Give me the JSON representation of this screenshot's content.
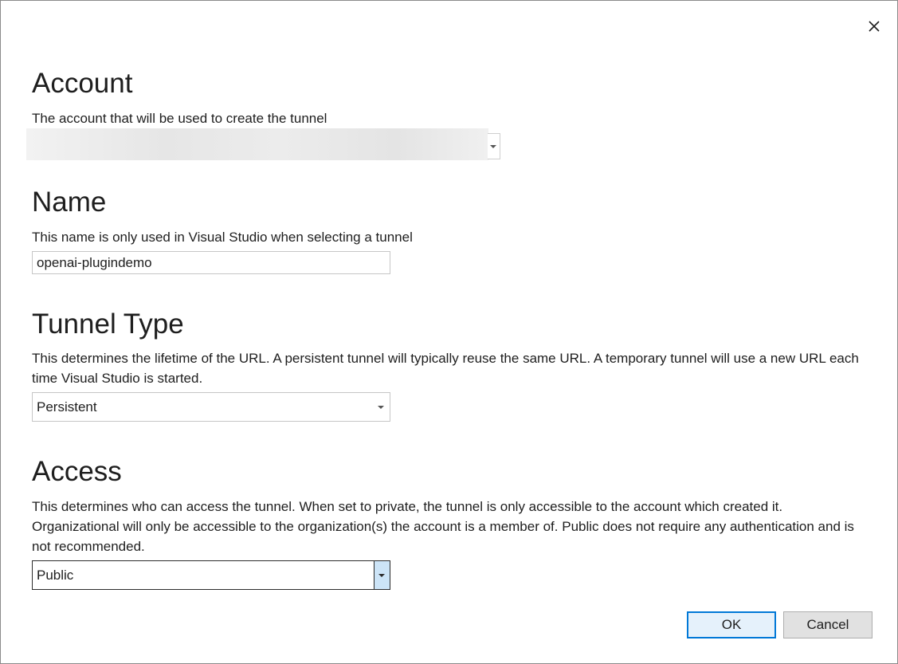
{
  "dialog": {
    "close_glyph": "✕"
  },
  "account": {
    "title": "Account",
    "description": "The account that will be used to create the tunnel",
    "value": ""
  },
  "name": {
    "title": "Name",
    "description": "This name is only used in Visual Studio when selecting a tunnel",
    "value": "openai-plugindemo"
  },
  "tunnel_type": {
    "title": "Tunnel Type",
    "description": "This determines the lifetime of the URL. A persistent tunnel will typically reuse the same URL. A temporary tunnel will use a new URL each time Visual Studio is started.",
    "selected": "Persistent"
  },
  "access": {
    "title": "Access",
    "description": "This determines who can access the tunnel. When set to private, the tunnel is only accessible to the account which created it. Organizational will only be accessible to the organization(s) the account is a member of. Public does not require any authentication and is not recommended.",
    "selected": "Public"
  },
  "buttons": {
    "ok": "OK",
    "cancel": "Cancel"
  },
  "icons": {
    "close": "close-icon",
    "dropdown": "chevron-down-icon"
  },
  "colors": {
    "accent": "#0078d7",
    "focused_dropdown_button": "#cce4f7"
  }
}
